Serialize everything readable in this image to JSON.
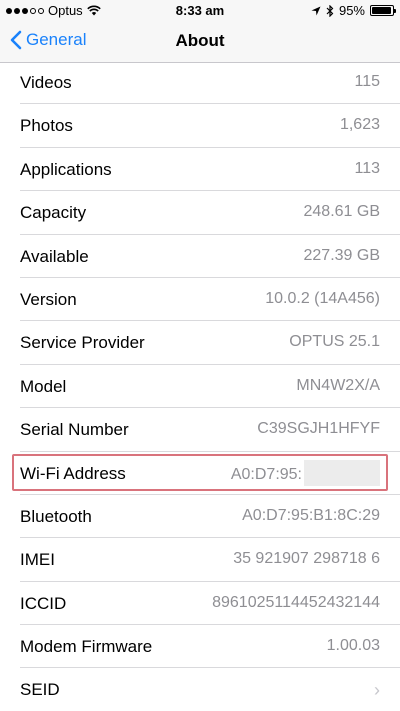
{
  "status_bar": {
    "carrier": "Optus",
    "time": "8:33 am",
    "battery_percent": "95%",
    "battery_level": 0.95
  },
  "nav": {
    "back_label": "General",
    "title": "About"
  },
  "rows": [
    {
      "label": "Videos",
      "value": "115"
    },
    {
      "label": "Photos",
      "value": "1,623"
    },
    {
      "label": "Applications",
      "value": "113"
    },
    {
      "label": "Capacity",
      "value": "248.61 GB"
    },
    {
      "label": "Available",
      "value": "227.39 GB"
    },
    {
      "label": "Version",
      "value": "10.0.2 (14A456)"
    },
    {
      "label": "Service Provider",
      "value": "OPTUS 25.1"
    },
    {
      "label": "Model",
      "value": "MN4W2X/A"
    },
    {
      "label": "Serial Number",
      "value": "C39SGJH1HFYF"
    },
    {
      "label": "Wi-Fi Address",
      "value": "A0:D7:95:"
    },
    {
      "label": "Bluetooth",
      "value": "A0:D7:95:B1:8C:29"
    },
    {
      "label": "IMEI",
      "value": "35 921907 298718 6"
    },
    {
      "label": "ICCID",
      "value": "8961025114452432144"
    },
    {
      "label": "Modem Firmware",
      "value": "1.00.03"
    },
    {
      "label": "SEID",
      "value": ""
    }
  ],
  "colors": {
    "accent": "#1a82fb",
    "value_text": "#8e8e93",
    "highlight": "#d9737c"
  },
  "icons": [
    "signal-dots-icon",
    "wifi-icon",
    "location-arrow-icon",
    "bluetooth-icon",
    "battery-icon",
    "back-chevron-icon",
    "disclosure-chevron-icon"
  ]
}
